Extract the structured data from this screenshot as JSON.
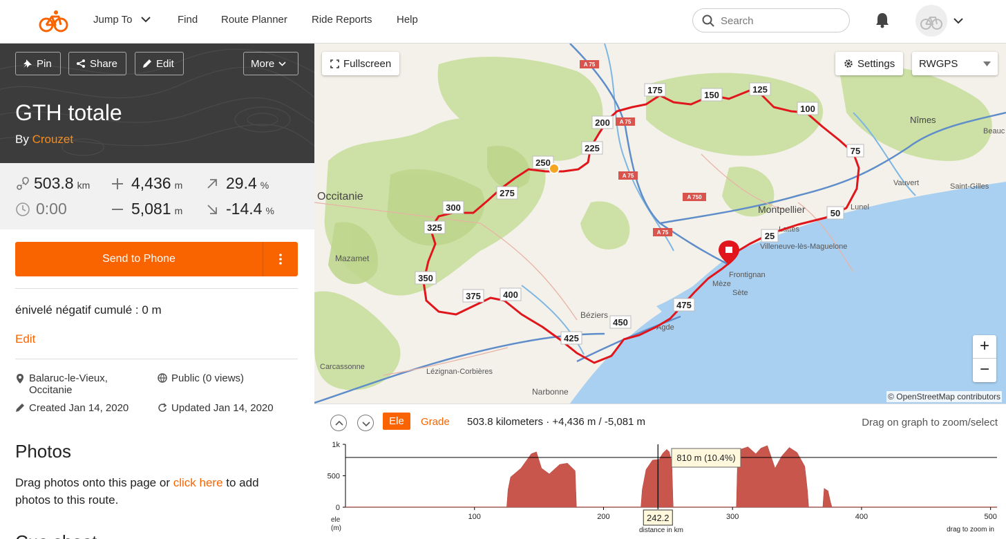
{
  "nav": {
    "items": [
      "Jump To",
      "Find",
      "Route Planner",
      "Ride Reports",
      "Help"
    ],
    "search_placeholder": "Search"
  },
  "route": {
    "buttons": {
      "pin": "Pin",
      "share": "Share",
      "edit": "Edit",
      "more": "More"
    },
    "title": "GTH totale",
    "by_label": "By",
    "author": "Crouzet",
    "stats": {
      "distance": "503.8",
      "distance_unit": "km",
      "time": "0:00",
      "gain": "4,436",
      "gain_unit": "m",
      "loss": "5,081",
      "loss_unit": "m",
      "max_grade": "29.4",
      "max_grade_unit": "%",
      "min_grade": "-14.4",
      "min_grade_unit": "%"
    },
    "send_label": "Send to Phone",
    "description": "énivelé négatif cumulé : 0 m",
    "edit_link": "Edit",
    "location": "Balaruc-le-Vieux, Occitanie",
    "visibility": "Public (0 views)",
    "created": "Created Jan 14, 2020",
    "updated": "Updated Jan 14, 2020",
    "photos_title": "Photos",
    "photos_text_before": "Drag photos onto this page or",
    "photos_link": "click here",
    "photos_text_after": "to add photos to this route.",
    "next_section_partial": "Cue sheet"
  },
  "map": {
    "fullscreen_label": "Fullscreen",
    "settings_label": "Settings",
    "layer": "RWGPS",
    "attribution": "© OpenStreetMap contributors",
    "place_labels": [
      "Occitanie",
      "Mazamet",
      "Montpellier",
      "Lattes",
      "Villeneuve-lès-Maguelone",
      "Frontignan",
      "Sète",
      "Béziers",
      "Agde",
      "Carcassonne",
      "Lézignan-Corbières",
      "Narbonne",
      "Nîmes",
      "Vauvert",
      "Saint-Gilles",
      "Lunel",
      "Beauc",
      "Mèze"
    ],
    "road_labels": [
      "A 75",
      "A 75",
      "A 75",
      "A 750",
      "A 75"
    ],
    "distance_markers": [
      "25",
      "50",
      "75",
      "100",
      "125",
      "150",
      "175",
      "200",
      "225",
      "250",
      "275",
      "300",
      "325",
      "350",
      "375",
      "400",
      "425",
      "450",
      "475"
    ]
  },
  "elevation": {
    "tabs": {
      "ele": "Ele",
      "grade": "Grade"
    },
    "summary": "503.8 kilometers · +4,436 m / -5,081 m",
    "hint": "Drag on graph to zoom/select",
    "y_ticks": [
      "1k",
      "500",
      "0"
    ],
    "x_ticks": [
      "100",
      "200",
      "300",
      "400",
      "500"
    ],
    "y_label": "ele (m)",
    "x_label": "distance in km",
    "zoom_hint": "drag to zoom in",
    "cursor_value": "242.2",
    "tooltip": "810 m (10.4%)"
  },
  "colors": {
    "accent": "#fa6400",
    "route": "#e0161c",
    "profile": "#c9564d"
  },
  "chart_data": {
    "type": "area",
    "xlabel": "distance in km",
    "ylabel": "ele (m)",
    "xlim": [
      0,
      505
    ],
    "ylim": [
      0,
      1000
    ],
    "x": [
      0,
      125,
      126,
      128,
      136,
      144,
      148,
      152,
      158,
      166,
      172,
      178,
      179,
      229,
      230,
      233,
      238,
      243,
      246,
      249,
      251,
      253,
      254,
      303,
      304,
      306,
      312,
      318,
      322,
      327,
      333,
      338,
      344,
      350,
      356,
      358,
      359,
      370,
      371,
      374,
      376,
      377,
      505
    ],
    "y": [
      5,
      5,
      280,
      480,
      620,
      850,
      880,
      620,
      530,
      680,
      700,
      580,
      5,
      5,
      280,
      600,
      750,
      760,
      860,
      920,
      880,
      700,
      5,
      5,
      880,
      920,
      960,
      850,
      940,
      980,
      620,
      810,
      950,
      870,
      650,
      280,
      5,
      5,
      300,
      260,
      80,
      5,
      5
    ]
  }
}
